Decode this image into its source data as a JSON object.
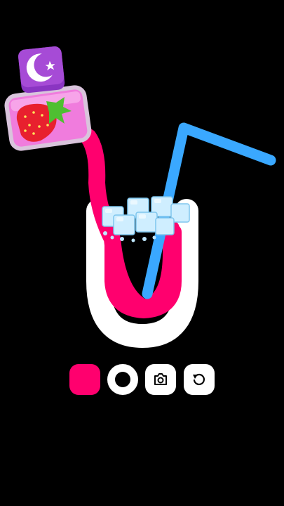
{
  "game": {
    "liquid_color": "#ff006e",
    "cup_color": "#ffffff",
    "straw_color": "#3aa8ff",
    "ice_color": "#bfe8ff",
    "jar_color": "#f07cdd",
    "lid_color": "#a64bd6",
    "fruit": "strawberry",
    "lid_symbol": "star-and-crescent"
  },
  "toolbar": {
    "color_swatch": "#ff006e",
    "brush_icon": "dot-icon",
    "camera_icon": "camera-icon",
    "undo_icon": "undo-icon"
  }
}
